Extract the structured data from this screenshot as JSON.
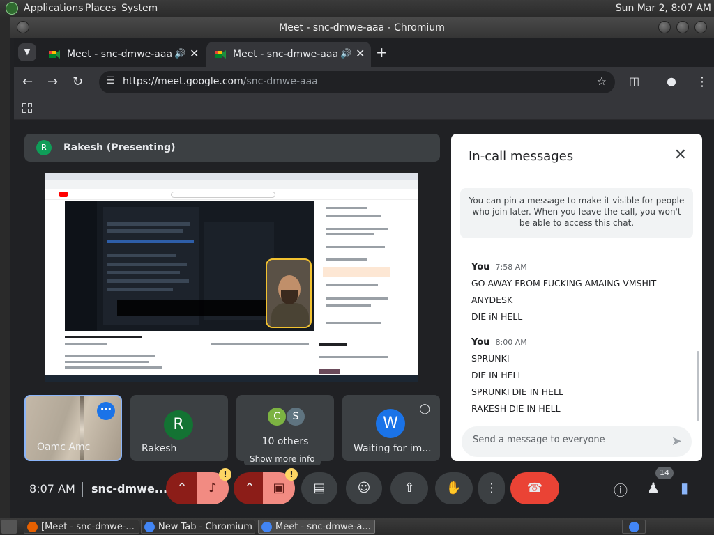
{
  "system_panel": {
    "menus": [
      "Applications",
      "Places",
      "System"
    ],
    "clock": "Sun Mar 2,  8:07 AM"
  },
  "window": {
    "title": "Meet - snc-dmwe-aaa - Chromium"
  },
  "browser": {
    "tabs": [
      {
        "label": "Meet - snc-dmwe-aaa"
      },
      {
        "label": "Meet - snc-dmwe-aaa"
      }
    ],
    "url_host": "https://meet.google.com",
    "url_path": "/snc-dmwe-aaa"
  },
  "meet": {
    "presenter": {
      "initial": "R",
      "label": "Rakesh (Presenting)"
    },
    "tiles": {
      "self_name": "Oamc Amc",
      "rakesh": {
        "initial": "R",
        "name": "Rakesh"
      },
      "others": {
        "initials": [
          "C",
          "S"
        ],
        "label": "10 others"
      },
      "waiting": {
        "initial": "W",
        "name": "Waiting for im..."
      }
    },
    "tooltip": "Show more info",
    "bottom": {
      "time": "8:07 AM",
      "meeting_code": "snc-dmwe..."
    },
    "participant_count": "14",
    "colors": {
      "accent": "#8ab4f8",
      "hangup": "#ea4335",
      "mic_off": "#8c1d18"
    }
  },
  "chat": {
    "title": "In-call messages",
    "pin_note": "You can pin a message to make it visible for people who join later. When you leave the call, you won't be able to access this chat.",
    "groups": [
      {
        "sender": "You",
        "time": "7:58 AM",
        "messages": [
          "GO AWAY FROM FUCKING AMAING VMSHIT",
          "ANYDESK",
          "DIE iN HELL"
        ]
      },
      {
        "sender": "You",
        "time": "8:00 AM",
        "messages": [
          "SPRUNKI",
          "DIE IN HELL",
          "SPRUNKI DIE IN HELL",
          "RAKESH DIE IN HELL"
        ]
      }
    ],
    "input_placeholder": "Send a message to everyone"
  },
  "taskbar": {
    "items": [
      "[Meet - snc-dmwe-...",
      "New Tab - Chromium",
      "Meet - snc-dmwe-a..."
    ]
  }
}
